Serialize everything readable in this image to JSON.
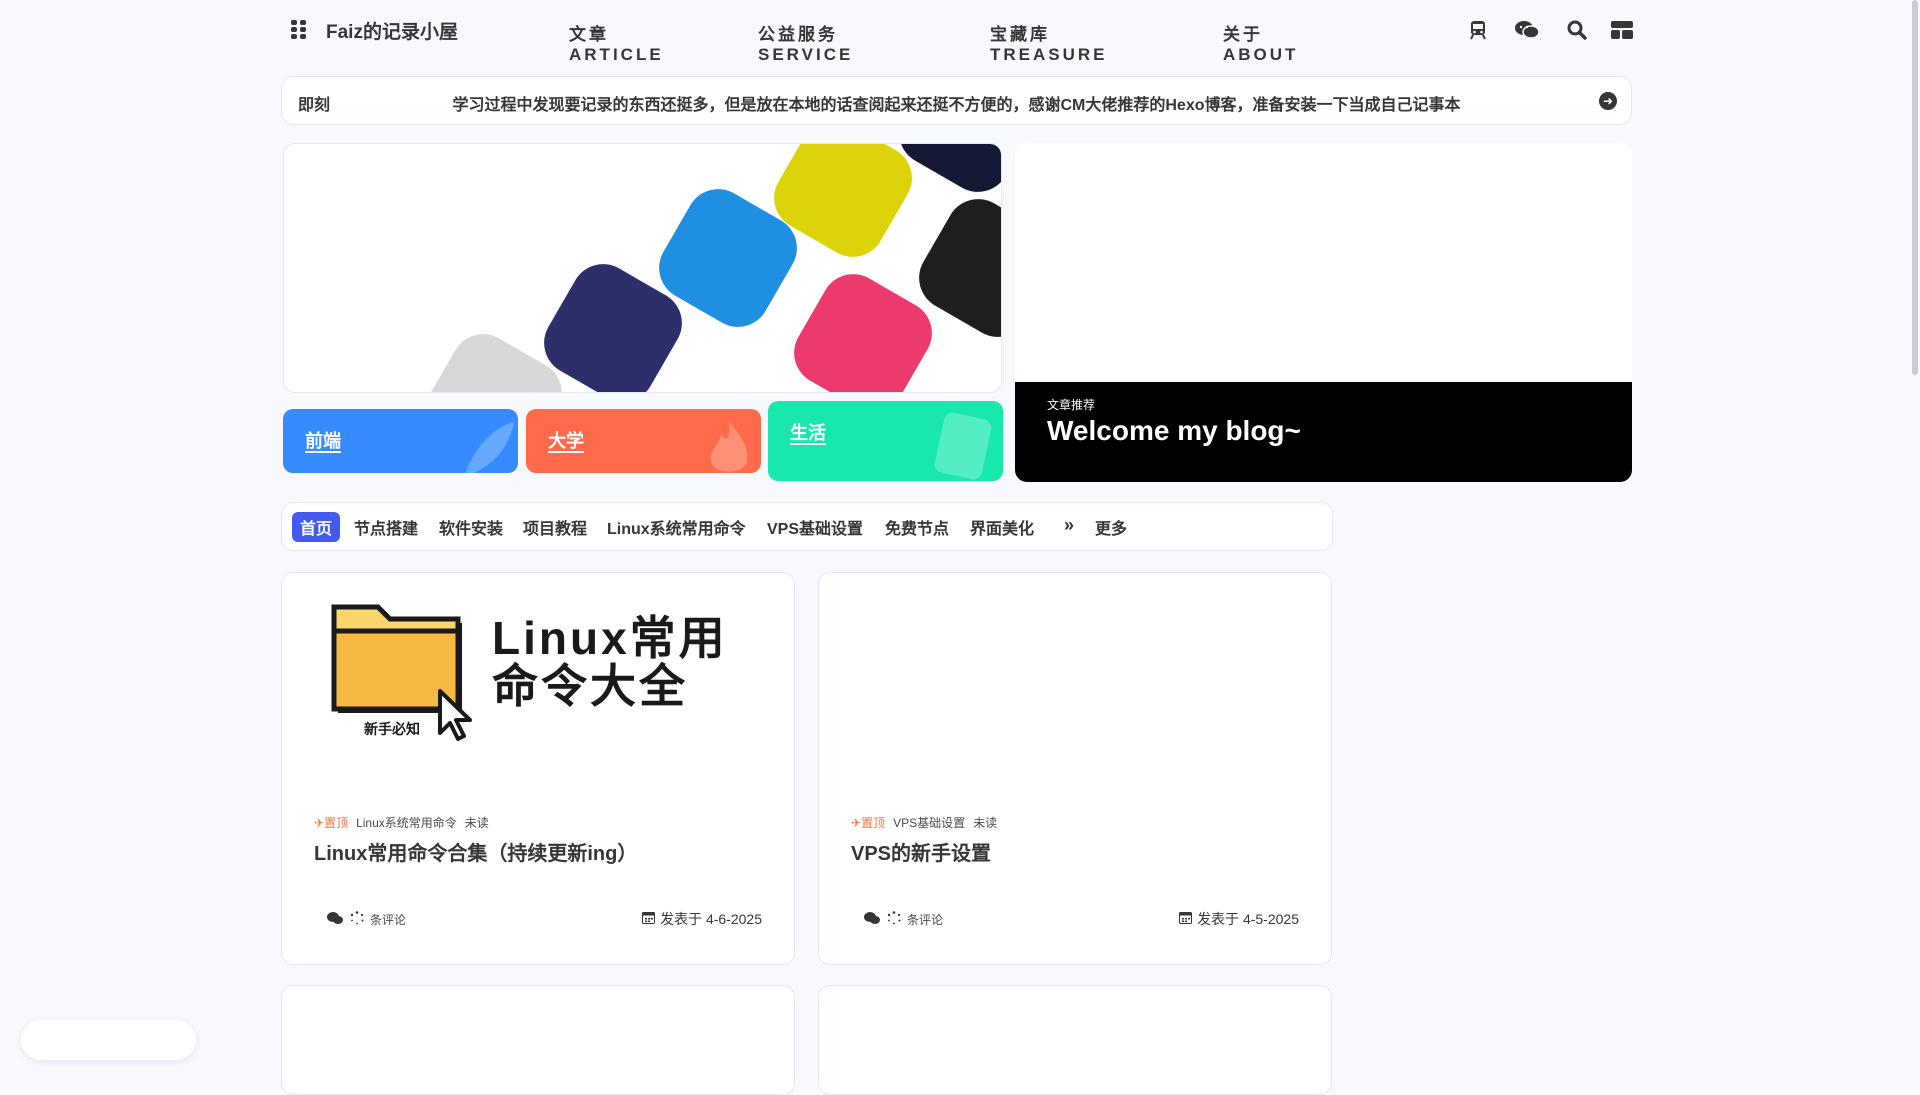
{
  "site": {
    "name": "Faiz的记录小屋"
  },
  "nav": {
    "links": [
      "文章ARTICLE",
      "公益服务SERVICE",
      "宝藏库TREASURE",
      "关于ABOUT"
    ],
    "icons": [
      "train-icon",
      "wechat-icon",
      "search-icon",
      "layout-icon"
    ]
  },
  "announce": {
    "label": "即刻",
    "text": "学习过程中发现要记录的东西还挺多，但是放在本地的话查阅起来还挺不方便的，感谢CM大佬推荐的Hexo博客，准备安装一下当成自己记事本"
  },
  "categories": [
    {
      "label": "前端",
      "color": "#358bff"
    },
    {
      "label": "大学",
      "color": "#ff6b4a"
    },
    {
      "label": "生活",
      "color": "#18e7ae"
    }
  ],
  "recommend": {
    "tag": "文章推荐",
    "title": "Welcome my blog~"
  },
  "tabs": {
    "items": [
      "首页",
      "节点搭建",
      "软件安装",
      "项目教程",
      "Linux系统常用命令",
      "VPS基础设置",
      "免费节点",
      "界面美化"
    ],
    "more": "更多"
  },
  "posts": [
    {
      "cover_title_line1": "Linux常用",
      "cover_title_line2": "命令大全",
      "cover_subtitle": "新手必知",
      "pin": "置顶",
      "category": "Linux系统常用命令",
      "status": "未读",
      "title": "Linux常用命令合集（持续更新ing）",
      "comments_suffix": "条评论",
      "date": "发表于 4-6-2025"
    },
    {
      "pin": "置顶",
      "category": "VPS基础设置",
      "status": "未读",
      "title": "VPS的新手设置",
      "comments_suffix": "条评论",
      "date": "发表于 4-5-2025"
    }
  ],
  "colors": {
    "accent": "#425aef",
    "pin": "#ff7242",
    "background": "#f7f9fe"
  }
}
